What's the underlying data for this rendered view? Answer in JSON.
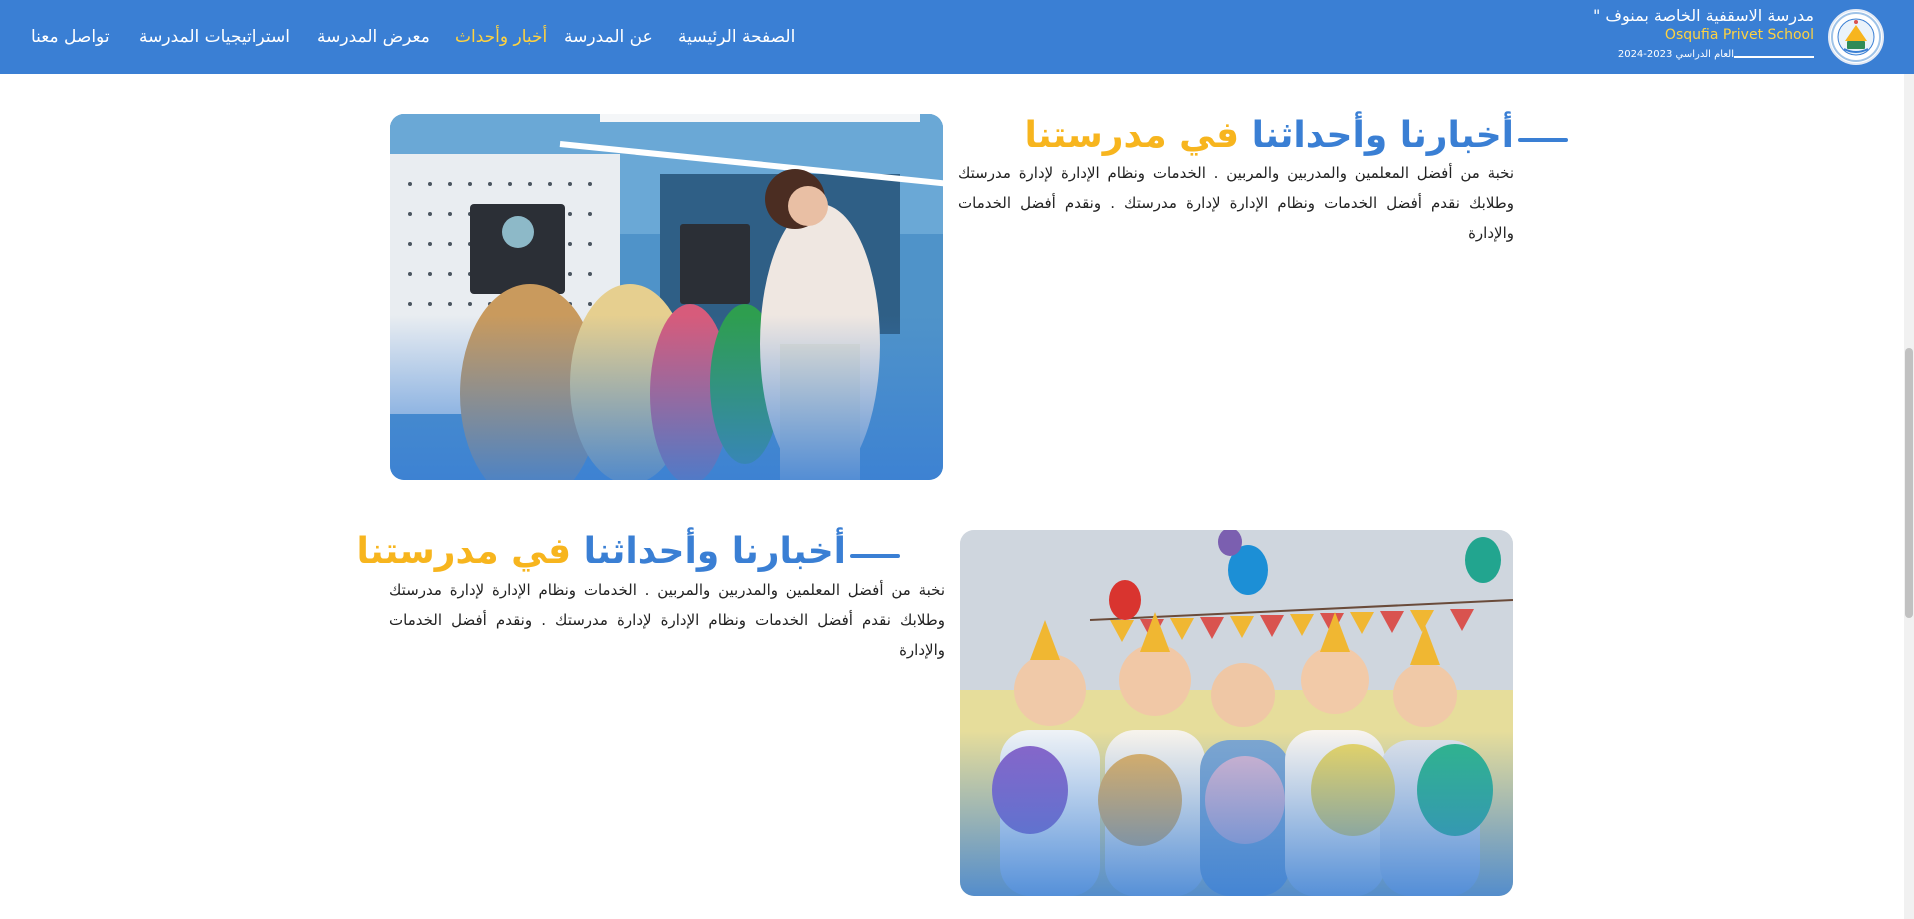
{
  "header": {
    "school_name_ar": "مدرسة الاسقفية الخاصة بمنوف \"",
    "school_name_en": "Osqufia Privet School",
    "school_year": "العام الدراسي 2023-2024",
    "logo_icon": "school-crest-logo",
    "bg_color": "#3a7fd4",
    "accent_color": "#ffd23f"
  },
  "nav": {
    "items": [
      {
        "label": "الصفحة الرئيسية",
        "active": false
      },
      {
        "label": "عن المدرسة",
        "active": false
      },
      {
        "label": "أخبار وأحداث",
        "active": true
      },
      {
        "label": "معرض المدرسة",
        "active": false
      },
      {
        "label": "استراتيجيات المدرسة",
        "active": false
      },
      {
        "label": "تواصل معنا",
        "active": false
      }
    ]
  },
  "sections": [
    {
      "title_main": "أخبارنا وأحداثنا ",
      "title_accent": "في مدرستنا",
      "text": "نخبة من أفضل المعلمين والمدربين والمربين . الخدمات ونظام الإدارة لإدارة مدرستك وطلابك نقدم أفضل الخدمات ونظام الإدارة لإدارة مدرستك . ونقدم أفضل الخدمات والإدارة",
      "image": "teacher-with-students-science-lab-photo"
    },
    {
      "title_main": "أخبارنا وأحداثنا ",
      "title_accent": "في مدرستنا",
      "text": "نخبة من أفضل المعلمين والمدربين والمربين . الخدمات ونظام الإدارة لإدارة مدرستك وطلابك نقدم أفضل الخدمات ونظام الإدارة لإدارة مدرستك . ونقدم أفضل الخدمات والإدارة",
      "image": "kids-birthday-party-balloons-photo"
    }
  ]
}
